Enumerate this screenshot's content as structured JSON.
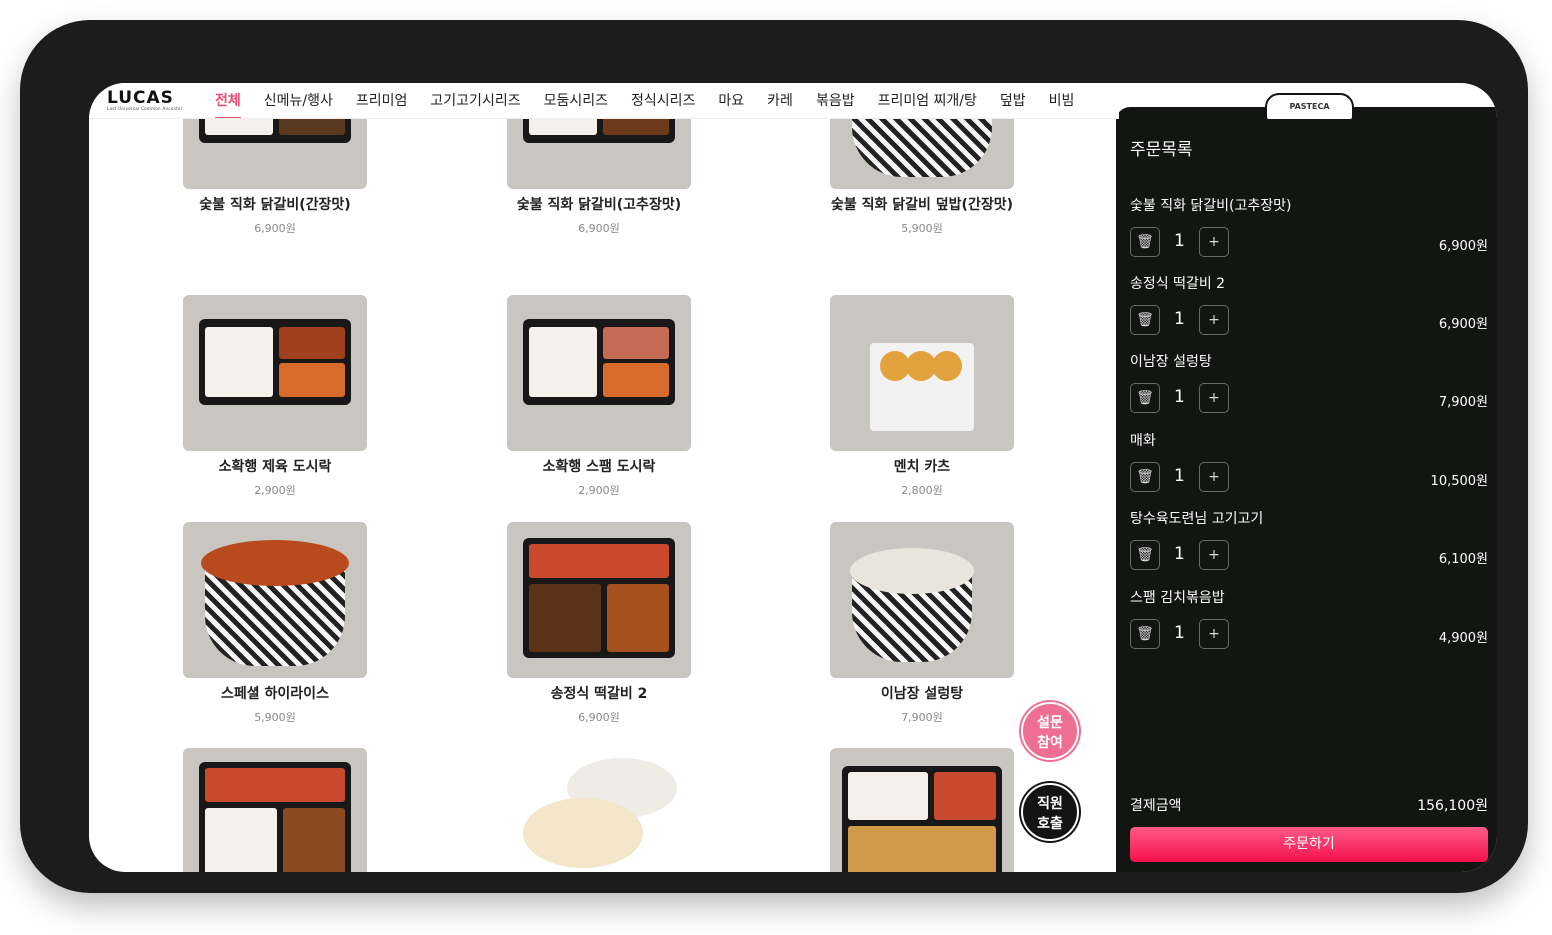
{
  "brand": {
    "logo": "LUCAS",
    "tagline": "Last Universal Common Ancestor",
    "partner_tab": "PASTECA"
  },
  "nav": {
    "items": [
      "전체",
      "신메뉴/행사",
      "프리미엄",
      "고기고기시리즈",
      "모둠시리즈",
      "정식시리즈",
      "마요",
      "카레",
      "볶음밥",
      "프리미엄 찌개/탕",
      "덮밥",
      "비빔"
    ],
    "active_index": 0
  },
  "menu": [
    {
      "name": "숯불 직화 닭갈비(간장맛)",
      "price": "6,900원"
    },
    {
      "name": "숯불 직화 닭갈비(고추장맛)",
      "price": "6,900원"
    },
    {
      "name": "숯불 직화 닭갈비 덮밥(간장맛)",
      "price": "5,900원"
    },
    {
      "name": "소확행 제육 도시락",
      "price": "2,900원"
    },
    {
      "name": "소확행 스팸 도시락",
      "price": "2,900원"
    },
    {
      "name": "멘치 카츠",
      "price": "2,800원"
    },
    {
      "name": "스페셜 하이라이스",
      "price": "5,900원"
    },
    {
      "name": "송정식 떡갈비 2",
      "price": "6,900원"
    },
    {
      "name": "이남장 설렁탕",
      "price": "7,900원"
    }
  ],
  "floating": {
    "survey": "설문\n참여",
    "survey_line1": "설문",
    "survey_line2": "참여",
    "staff_line1": "직원",
    "staff_line2": "호출"
  },
  "order": {
    "title": "주문목록",
    "items": [
      {
        "name": "숯불 직화 닭갈비(고추장맛)",
        "qty": "1",
        "price": "6,900원"
      },
      {
        "name": "송정식 떡갈비 2",
        "qty": "1",
        "price": "6,900원"
      },
      {
        "name": "이남장 설렁탕",
        "qty": "1",
        "price": "7,900원"
      },
      {
        "name": "매화",
        "qty": "1",
        "price": "10,500원"
      },
      {
        "name": "탕수육도련님 고기고기",
        "qty": "1",
        "price": "6,100원"
      },
      {
        "name": "스팸 김치볶음밥",
        "qty": "1",
        "price": "4,900원"
      }
    ],
    "total_label": "결제금액",
    "total_value": "156,100원",
    "submit_label": "주문하기"
  },
  "icons": {
    "delete": "trash-icon",
    "increase": "plus-icon"
  },
  "colors": {
    "accent": "#e94f75",
    "panel_bg": "#121512",
    "order_button": "#f5124e",
    "survey_button": "#ef6f92",
    "staff_button": "#141414"
  }
}
